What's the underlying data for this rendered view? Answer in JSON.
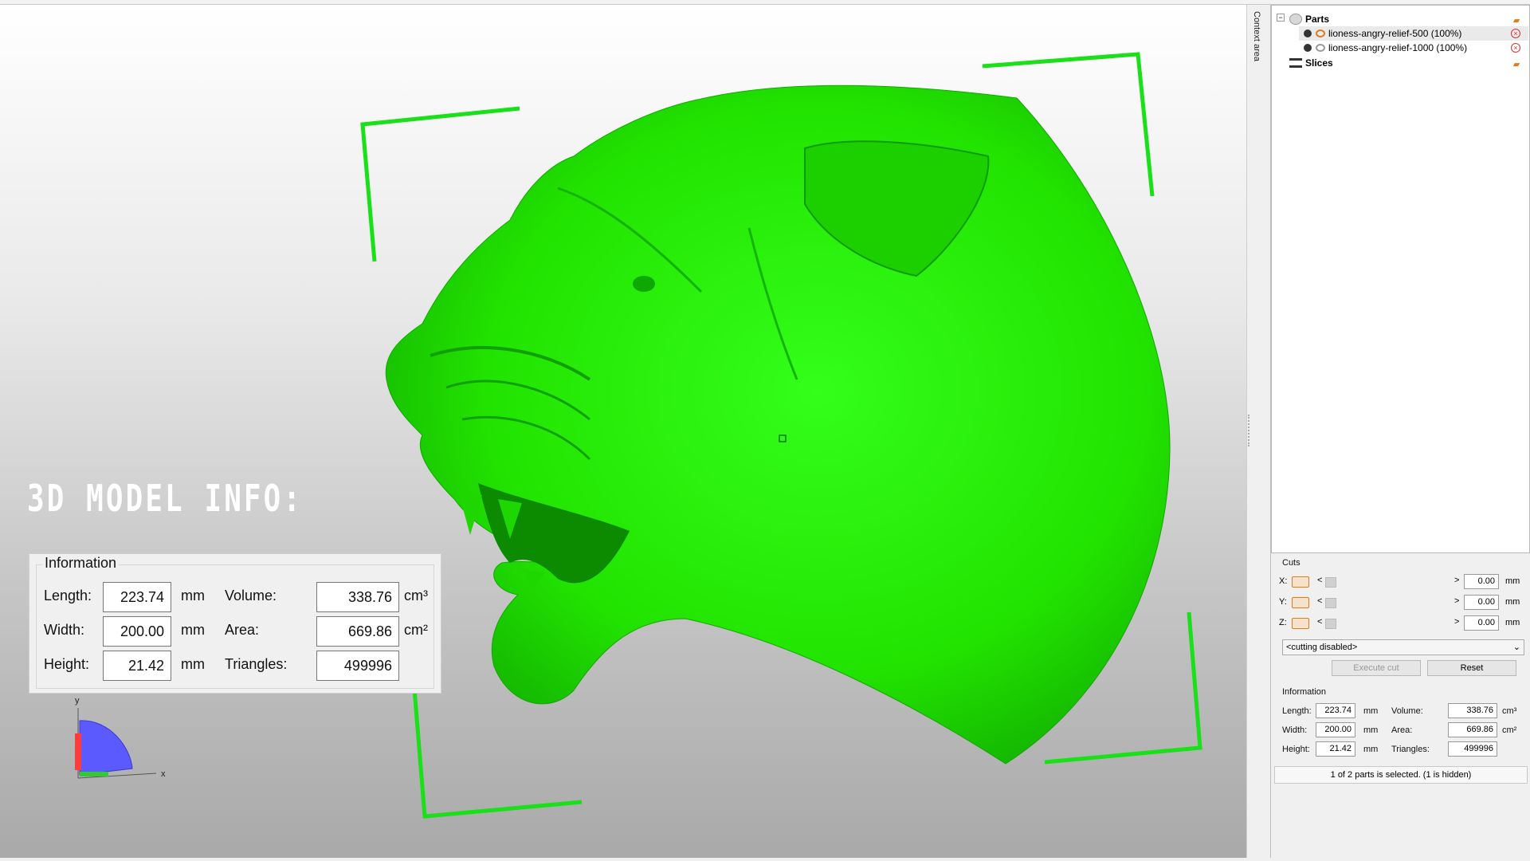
{
  "overlay": {
    "title": "3D MODEL INFO:"
  },
  "context_tab": {
    "label": "Context area"
  },
  "model_info_panel": {
    "title": "Information",
    "length_label": "Length:",
    "length_value": "223.74",
    "length_unit": "mm",
    "width_label": "Width:",
    "width_value": "200.00",
    "width_unit": "mm",
    "height_label": "Height:",
    "height_value": "21.42",
    "height_unit": "mm",
    "volume_label": "Volume:",
    "volume_value": "338.76",
    "volume_unit": "cm³",
    "area_label": "Area:",
    "area_value": "669.86",
    "area_unit": "cm²",
    "triangles_label": "Triangles:",
    "triangles_value": "499996"
  },
  "axis_gizmo": {
    "y_label": "y",
    "x_label": "x"
  },
  "tree": {
    "parts_label": "Parts",
    "items": [
      {
        "label": "lioness-angry-relief-500 (100%)",
        "highlighted": true
      },
      {
        "label": "lioness-angry-relief-1000 (100%)",
        "highlighted": false
      }
    ],
    "slices_label": "Slices"
  },
  "cuts": {
    "title": "Cuts",
    "rows": [
      {
        "axis": "X:",
        "value": "0.00",
        "unit": "mm"
      },
      {
        "axis": "Y:",
        "value": "0.00",
        "unit": "mm"
      },
      {
        "axis": "Z:",
        "value": "0.00",
        "unit": "mm"
      }
    ],
    "select_value": "<cutting disabled>",
    "execute_label": "Execute cut",
    "reset_label": "Reset"
  },
  "side_info": {
    "title": "Information",
    "length_label": "Length:",
    "length_value": "223.74",
    "length_unit": "mm",
    "width_label": "Width:",
    "width_value": "200.00",
    "width_unit": "mm",
    "height_label": "Height:",
    "height_value": "21.42",
    "height_unit": "mm",
    "volume_label": "Volume:",
    "volume_value": "338.76",
    "volume_unit": "cm³",
    "area_label": "Area:",
    "area_value": "669.86",
    "area_unit": "cm²",
    "triangles_label": "Triangles:",
    "triangles_value": "499996"
  },
  "status": {
    "text": "1 of 2 parts is selected. (1 is hidden)"
  },
  "colors": {
    "model": "#22e300",
    "bracket": "#19e019",
    "accent": "#e07a1f"
  }
}
